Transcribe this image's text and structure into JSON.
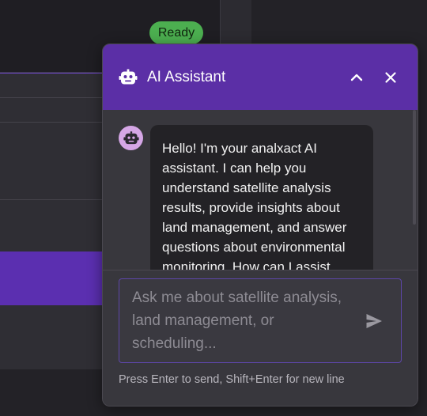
{
  "status": {
    "label": "Ready",
    "color": "#4caf50"
  },
  "chat": {
    "title": "AI Assistant",
    "header_icon": "robot-icon",
    "collapse_icon": "chevron-up-icon",
    "close_icon": "close-icon",
    "accent": "#5b2fa6",
    "messages": [
      {
        "sender": "assistant",
        "avatar_icon": "robot-icon",
        "text": "Hello! I'm your analxact AI assistant. I can help you understand satellite analysis results, provide insights about land management, and answer questions about environmental monitoring. How can I assist"
      }
    ],
    "input": {
      "placeholder": "Ask me about satellite analysis, land management, or scheduling...",
      "value": ""
    },
    "send_icon": "send-icon",
    "hint": "Press Enter to send, Shift+Enter for new line"
  }
}
